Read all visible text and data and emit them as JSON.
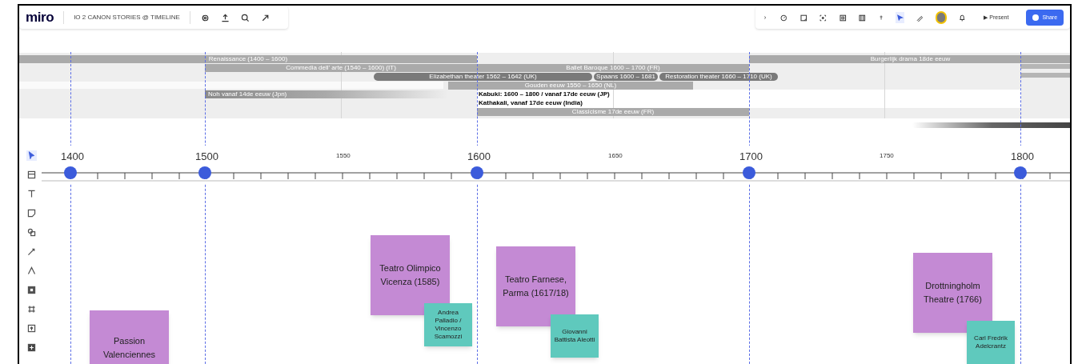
{
  "board": {
    "logo": "miro",
    "title": "IO 2 CANON STORIES @ TIMELINE"
  },
  "header_actions": {
    "present": "▶ Present",
    "share": "Share"
  },
  "tools": [
    {
      "kind": "select",
      "selected": true
    },
    {
      "kind": "frame",
      "selected": false
    },
    {
      "kind": "text",
      "selected": false
    },
    {
      "kind": "sticky",
      "selected": false
    },
    {
      "kind": "shapes",
      "selected": false
    },
    {
      "kind": "line",
      "selected": false
    },
    {
      "kind": "pen",
      "selected": false
    },
    {
      "kind": "comment",
      "selected": false
    },
    {
      "kind": "crop",
      "selected": false
    },
    {
      "kind": "upload",
      "selected": false
    },
    {
      "kind": "more",
      "selected": false
    }
  ],
  "periods": [
    {
      "kind": "bar",
      "label": "Renaissance (1400 – 1600)"
    },
    {
      "kind": "bar",
      "label": "Burgerlijk drama 18de eeuw"
    },
    {
      "kind": "bar",
      "label": "Commedia dell' arte (1540 – 1600) (IT)"
    },
    {
      "kind": "bar",
      "label": "Ballet Baroque 1600 – 1700 (FR)"
    },
    {
      "kind": "pill",
      "label": "Elizabethan theater 1562 – 1642 (UK)"
    },
    {
      "kind": "pill",
      "label": "Spaans 1600 – 1681"
    },
    {
      "kind": "pill",
      "label": "Restoration theater 1660 – 1710 (UK)"
    },
    {
      "kind": "bar",
      "label": "Gouden eeuw 1550 – 1650 (NL)"
    },
    {
      "kind": "fade",
      "label": "Noh vanaf 14de eeuw (Jpn)"
    },
    {
      "kind": "text",
      "label": "Kabuki: 1600 – 1800 / vanaf 17de eeuw (JP)"
    },
    {
      "kind": "text",
      "label": "Kathakali, vanaf 17de eeuw (India)"
    },
    {
      "kind": "bar",
      "label": "Classicisme 17de eeuw (FR)"
    }
  ],
  "timeline": {
    "years": [
      "1400",
      "1500",
      "1550",
      "1600",
      "1650",
      "1700",
      "1750",
      "1800"
    ]
  },
  "notes": [
    {
      "text": "Passion Valenciennes",
      "color": "#c48ad4"
    },
    {
      "text": "Teatro Olimpico Vicenza (1585)",
      "color": "#c48ad4"
    },
    {
      "text": "Andrea Palladio / Vincenzo Scamozzi",
      "color": "#5fc9bd"
    },
    {
      "text": "Teatro Farnese, Parma (1617/18)",
      "color": "#c48ad4"
    },
    {
      "text": "Giovanni Battista Aleotti",
      "color": "#5fc9bd"
    },
    {
      "text": "Drottningholm Theatre (1766)",
      "color": "#c48ad4"
    },
    {
      "text": "Carl Fredrik Adelcrantz",
      "color": "#5fc9bd"
    }
  ]
}
